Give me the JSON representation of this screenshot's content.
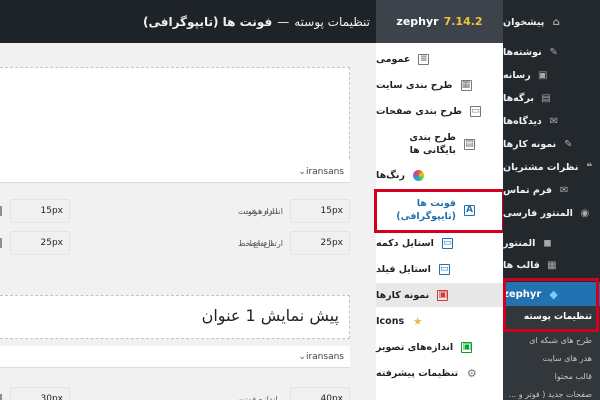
{
  "header": {
    "title_main": "تنظیمات پوسته",
    "title_sep": "—",
    "title_sub": "فونت ها (تایپوگرافی)",
    "brand": "zephyr",
    "version": "7.14.2"
  },
  "wp_menu": {
    "items": [
      {
        "label": "پیشخوان",
        "icon": "dashboard-icon",
        "glyph": "⌂"
      },
      {
        "label": "نوشته‌ها",
        "icon": "pin-icon",
        "glyph": "✎"
      },
      {
        "label": "رسانه",
        "icon": "media-icon",
        "glyph": "▣"
      },
      {
        "label": "برگه‌ها",
        "icon": "pages-icon",
        "glyph": "▤"
      },
      {
        "label": "دیدگاه‌ها",
        "icon": "comments-icon",
        "glyph": "✉"
      },
      {
        "label": "نمونه کارها",
        "icon": "portfolio-icon",
        "glyph": "✎"
      },
      {
        "label": "نظرات مشتریان",
        "icon": "testimonial-icon",
        "glyph": "❝"
      },
      {
        "label": "فرم تماس",
        "icon": "mail-icon",
        "glyph": "✉"
      },
      {
        "label": "المنتور فارسی",
        "icon": "elementor-fa-icon",
        "glyph": "◉"
      },
      {
        "label": "المنتور",
        "icon": "elementor-icon",
        "glyph": "◼"
      },
      {
        "label": "قالب ها",
        "icon": "templates-icon",
        "glyph": "▦"
      }
    ],
    "zephyr": {
      "label": "zephyr",
      "icon": "diamond-icon",
      "glyph": "◆"
    },
    "submenu": [
      {
        "label": "تنظیمات پوسته",
        "current": true
      },
      {
        "label": "طرح های شبکه ای"
      },
      {
        "label": "هدر های سایت"
      },
      {
        "label": "قالب محتوا"
      },
      {
        "label": "صفحات جدید ( فوتر و ..."
      }
    ]
  },
  "plugin_nav": {
    "items": [
      {
        "label": "عمومی",
        "icon": "general-icon",
        "glyph": "≡"
      },
      {
        "label": "طرح بندی سایت",
        "icon": "site-layout-icon",
        "glyph": "▦"
      },
      {
        "label": "طرح بندی صفحات",
        "icon": "page-layout-icon",
        "glyph": "▭"
      },
      {
        "label": "طرح بندی بایگانی ها",
        "icon": "archive-layout-icon",
        "glyph": "▤"
      },
      {
        "label": "رنگ‌ها",
        "icon": "colors-icon",
        "glyph": "●"
      },
      {
        "label": "فونت ها (تایپوگرافی)",
        "icon": "fonts-icon",
        "glyph": "A",
        "active": true
      },
      {
        "label": "استایل دکمه",
        "icon": "button-style-icon",
        "glyph": "▭"
      },
      {
        "label": "استایل فیلد",
        "icon": "field-style-icon",
        "glyph": "▭"
      },
      {
        "label": "نمونه کارها",
        "icon": "portfolio-nav-icon",
        "glyph": "▣"
      },
      {
        "label": "Icons",
        "icon": "star-icon",
        "glyph": "★"
      },
      {
        "label": "اندازه‌های تصویر",
        "icon": "image-sizes-icon",
        "glyph": "▣"
      },
      {
        "label": "تنظیمات پیشرفته",
        "icon": "advanced-gear-icon",
        "glyph": "⚙"
      }
    ]
  },
  "main": {
    "font_select_1": "iransans",
    "font_select_2": "iransans",
    "preview_heading": "پیش نمایش 1 عنوان",
    "font_size_label": "اندازه فونت",
    "line_height_label": "ارتفاع خط",
    "font_size_value": "15px",
    "line_height_value": "25px",
    "font_size_value_2": "40px",
    "font_size_value_2_left": "30px"
  }
}
